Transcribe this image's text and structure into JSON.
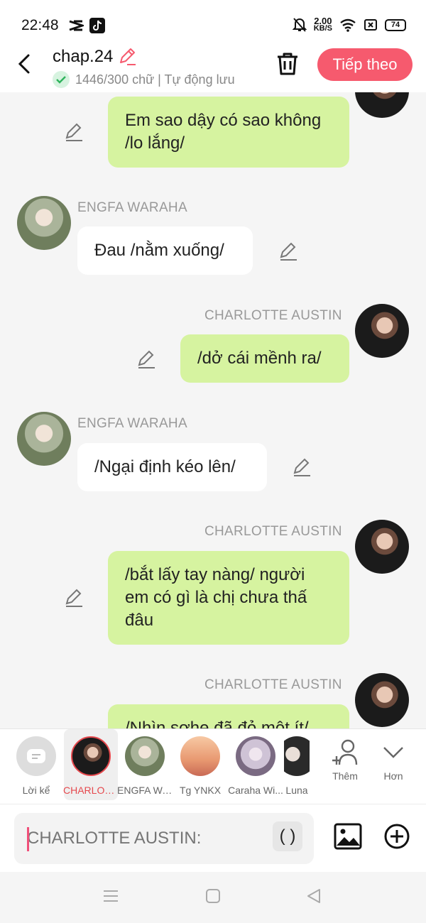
{
  "status_bar": {
    "time": "22:48",
    "net_speed_value": "2.00",
    "net_speed_unit": "KB/S",
    "battery": "74"
  },
  "header": {
    "title": "chap.24",
    "subtitle": "1446/300 chữ | Tự động lưu",
    "next_label": "Tiếp theo"
  },
  "messages": [
    {
      "side": "right",
      "speaker": "",
      "text": "Em sao dậy có sao không /lo lắng/",
      "color": "#d6f3a0"
    },
    {
      "side": "left",
      "speaker": "ENGFA WARAHA",
      "text": "Đau /nằm xuống/",
      "color": "#ffffff"
    },
    {
      "side": "right",
      "speaker": "CHARLOTTE AUSTIN",
      "text": "/dở cái mềnh ra/",
      "color": "#d6f3a0"
    },
    {
      "side": "left",
      "speaker": "ENGFA WARAHA",
      "text": "/Ngại định kéo lên/",
      "color": "#ffffff"
    },
    {
      "side": "right",
      "speaker": "CHARLOTTE AUSTIN",
      "text": "/bắt lấy tay nàng/ người em có gì là chị chưa thấ đâu",
      "color": "#d6f3a0"
    },
    {
      "side": "right",
      "speaker": "CHARLOTTE AUSTIN",
      "text": "/Nhìn sơhe đã đỏ một ít/",
      "color": "#d6f3a0"
    }
  ],
  "characters": [
    {
      "label": "Lời kể",
      "selected": false
    },
    {
      "label": "CHARLOTTE AUSTIN",
      "selected": true
    },
    {
      "label": "ENGFA WARAHA",
      "selected": false
    },
    {
      "label": "Tg YNKX",
      "selected": false
    },
    {
      "label": "Caraha Wi...",
      "selected": false
    },
    {
      "label": "Luna",
      "selected": false
    }
  ],
  "char_actions": {
    "add_label": "Thêm",
    "more_label": "Hơn"
  },
  "input": {
    "placeholder": "CHARLOTTE AUSTIN:",
    "paren_label": "( )"
  },
  "colors": {
    "accent": "#f65a6e",
    "my_bubble": "#d6f3a0",
    "other_bubble": "#ffffff",
    "selected_char": "#e5484d"
  }
}
